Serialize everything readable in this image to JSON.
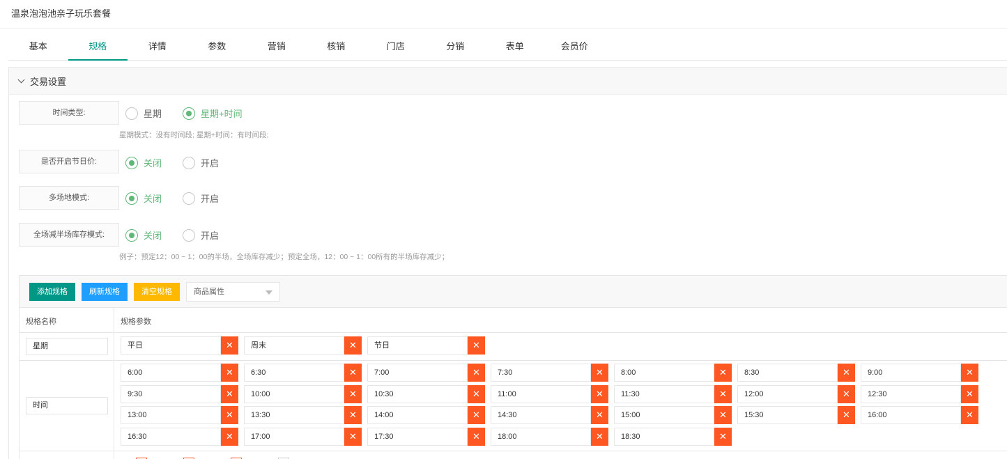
{
  "page": {
    "title": "温泉泡泡池亲子玩乐套餐"
  },
  "tabs": [
    {
      "label": "基本",
      "active": false
    },
    {
      "label": "规格",
      "active": true
    },
    {
      "label": "详情",
      "active": false
    },
    {
      "label": "参数",
      "active": false
    },
    {
      "label": "营销",
      "active": false
    },
    {
      "label": "核销",
      "active": false
    },
    {
      "label": "门店",
      "active": false
    },
    {
      "label": "分销",
      "active": false
    },
    {
      "label": "表单",
      "active": false
    },
    {
      "label": "会员价",
      "active": false
    }
  ],
  "section": {
    "title": "交易设置"
  },
  "form": {
    "time_type": {
      "label": "时间类型:",
      "options": [
        {
          "label": "星期",
          "checked": false
        },
        {
          "label": "星期+时间",
          "checked": true
        }
      ],
      "hint": "星期模式：没有时间段; 星期+时间：有时间段;"
    },
    "holiday_price": {
      "label": "是否开启节日价:",
      "options": [
        {
          "label": "关闭",
          "checked": true
        },
        {
          "label": "开启",
          "checked": false
        }
      ]
    },
    "multi_venue": {
      "label": "多场地模式:",
      "options": [
        {
          "label": "关闭",
          "checked": true
        },
        {
          "label": "开启",
          "checked": false
        }
      ]
    },
    "half_stock": {
      "label": "全场减半场库存模式:",
      "options": [
        {
          "label": "关闭",
          "checked": true
        },
        {
          "label": "开启",
          "checked": false
        }
      ],
      "hint": "例子：预定12：00 ~ 1：00的半场，全场库存减少；预定全场，12：00 ~ 1：00所有的半场库存减少；"
    }
  },
  "spec": {
    "buttons": {
      "add": "添加规格",
      "refresh": "刷新规格",
      "clear": "清空规格"
    },
    "select_placeholder": "商品属性",
    "columns": {
      "name": "规格名称",
      "params": "规格参数"
    },
    "rows": [
      {
        "name": "星期",
        "values": [
          "平日",
          "周末",
          "节日"
        ]
      },
      {
        "name": "时间",
        "values": [
          "6:00",
          "6:30",
          "7:00",
          "7:30",
          "8:00",
          "8:30",
          "9:00",
          "9:30",
          "10:00",
          "10:30",
          "11:00",
          "11:30",
          "12:00",
          "12:30",
          "13:00",
          "13:30",
          "14:00",
          "14:30",
          "15:00",
          "15:30",
          "16:00",
          "16:30",
          "17:00",
          "17:30",
          "18:00",
          "18:30"
        ]
      }
    ],
    "delete_glyph": "✕"
  },
  "colors": {
    "primary": "#009688",
    "checked": "#5fb878",
    "danger": "#ff5722",
    "info": "#1e9fff",
    "warn": "#ffb800"
  }
}
